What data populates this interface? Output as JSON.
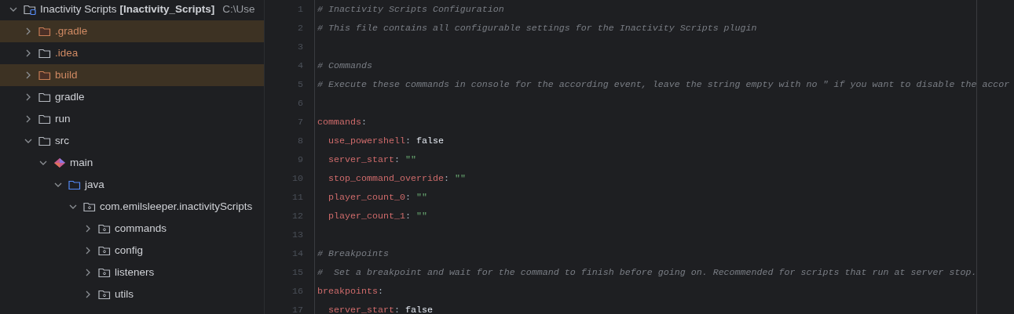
{
  "project_tree": {
    "root": {
      "name": "Inactivity Scripts",
      "module": "[Inactivity_Scripts]",
      "path": "C:\\Use",
      "expanded": true,
      "children": [
        {
          "name": ".gradle",
          "kind": "excluded",
          "highlighted": true,
          "expanded": false
        },
        {
          "name": ".idea",
          "kind": "ignored",
          "highlighted": false,
          "expanded": false
        },
        {
          "name": "build",
          "kind": "excluded",
          "highlighted": true,
          "expanded": false
        },
        {
          "name": "gradle",
          "kind": "folder",
          "highlighted": false,
          "expanded": false
        },
        {
          "name": "run",
          "kind": "folder",
          "highlighted": false,
          "expanded": false
        },
        {
          "name": "src",
          "kind": "folder",
          "highlighted": false,
          "expanded": true,
          "children": [
            {
              "name": "main",
              "kind": "module",
              "highlighted": false,
              "expanded": true,
              "children": [
                {
                  "name": "java",
                  "kind": "source",
                  "highlighted": false,
                  "expanded": true,
                  "children": [
                    {
                      "name": "com.emilsleeper.inactivityScripts",
                      "kind": "package",
                      "highlighted": false,
                      "expanded": true,
                      "children": [
                        {
                          "name": "commands",
                          "kind": "package",
                          "highlighted": false,
                          "expanded": false
                        },
                        {
                          "name": "config",
                          "kind": "package",
                          "highlighted": false,
                          "expanded": false
                        },
                        {
                          "name": "listeners",
                          "kind": "package",
                          "highlighted": false,
                          "expanded": false
                        },
                        {
                          "name": "utils",
                          "kind": "package",
                          "highlighted": false,
                          "expanded": false
                        }
                      ]
                    }
                  ]
                }
              ]
            }
          ]
        }
      ]
    }
  },
  "editor": {
    "lines": [
      {
        "number": "1",
        "kind": "comment",
        "text": "# Inactivity Scripts Configuration"
      },
      {
        "number": "2",
        "kind": "comment",
        "text": "# This file contains all configurable settings for the Inactivity Scripts plugin"
      },
      {
        "number": "3",
        "kind": "blank"
      },
      {
        "number": "4",
        "kind": "comment",
        "text": "# Commands"
      },
      {
        "number": "5",
        "kind": "comment",
        "text": "# Execute these commands in console for the according event, leave the string empty with no \" if you want to disable the accor"
      },
      {
        "number": "6",
        "kind": "blank"
      },
      {
        "number": "7",
        "kind": "section",
        "key": "commands",
        "colon": ":"
      },
      {
        "number": "8",
        "kind": "pair",
        "key": "use_powershell",
        "colon": ":",
        "value": {
          "text": "false",
          "kind": "boolean"
        }
      },
      {
        "number": "9",
        "kind": "pair",
        "key": "server_start",
        "colon": ":",
        "value": {
          "text": "\"\"",
          "kind": "string"
        }
      },
      {
        "number": "10",
        "kind": "pair",
        "key": "stop_command_override",
        "colon": ":",
        "value": {
          "text": "\"\"",
          "kind": "string"
        }
      },
      {
        "number": "11",
        "kind": "pair",
        "key": "player_count_0",
        "colon": ":",
        "value": {
          "text": "\"\"",
          "kind": "string"
        }
      },
      {
        "number": "12",
        "kind": "pair",
        "key": "player_count_1",
        "colon": ":",
        "value": {
          "text": "\"\"",
          "kind": "string"
        }
      },
      {
        "number": "13",
        "kind": "blank"
      },
      {
        "number": "14",
        "kind": "comment",
        "text": "# Breakpoints"
      },
      {
        "number": "15",
        "kind": "comment",
        "text": "#  Set a breakpoint and wait for the command to finish before going on. Recommended for scripts that run at server stop."
      },
      {
        "number": "16",
        "kind": "section",
        "key": "breakpoints",
        "colon": ":"
      },
      {
        "number": "17",
        "kind": "pair",
        "key": "server_start",
        "colon": ":",
        "value": {
          "text": "false",
          "kind": "boolean"
        }
      }
    ]
  }
}
